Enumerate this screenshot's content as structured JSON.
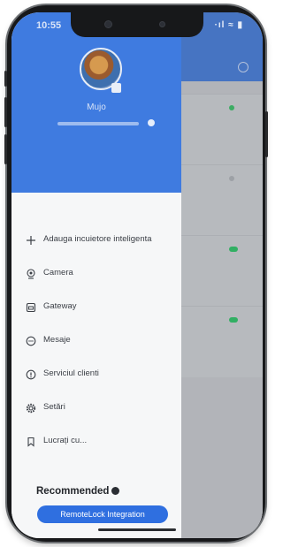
{
  "status_bar": {
    "time": "10:55",
    "icons": "·ıl ≈ ▮"
  },
  "profile": {
    "name": "Mujo"
  },
  "menu": {
    "items": [
      {
        "label": "Adauga incuietore inteligenta",
        "icon": "plus-icon"
      },
      {
        "label": "Camera",
        "icon": "camera-icon"
      },
      {
        "label": "Gateway",
        "icon": "gateway-icon"
      },
      {
        "label": "Mesaje",
        "icon": "message-icon"
      },
      {
        "label": "Serviciul clienti",
        "icon": "info-icon"
      },
      {
        "label": "Setări",
        "icon": "settings-icon"
      },
      {
        "label": "Lucrați cu...",
        "icon": "bookmark-icon"
      }
    ]
  },
  "recommended": {
    "title": "Recommended",
    "button_label": "RemoteLock Integration"
  },
  "colors": {
    "header_blue": "#3f7be0",
    "button_blue": "#2f6fe0",
    "status_green": "#33c26a"
  }
}
